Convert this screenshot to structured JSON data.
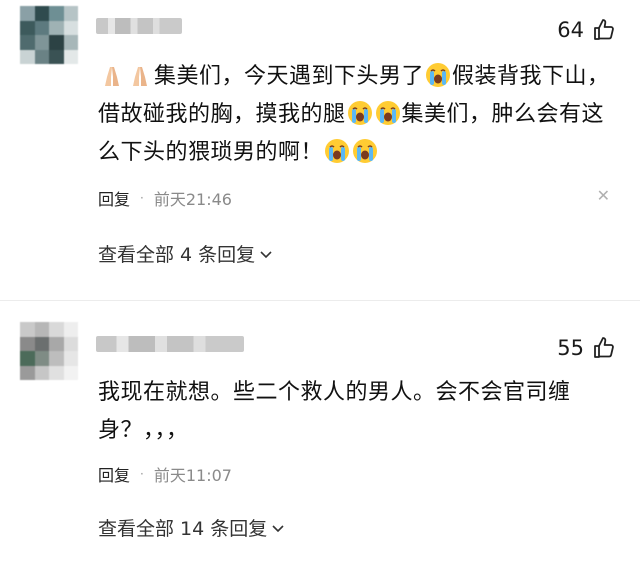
{
  "comments": [
    {
      "like_count": "64",
      "text_segments": [
        "集美们，今天遇到下头男了",
        "假装背我下山，借故碰我的胸，摸我的腿",
        "集美们，肿么会有这么下头的猥琐男的啊！"
      ],
      "reply_label": "回复",
      "time": "前天21:46",
      "view_replies": "查看全部 4 条回复",
      "avatar_colors": [
        "#8aa0a6",
        "#2f4b4e",
        "#6e8f94",
        "#b6c4c6",
        "#3d5a5c",
        "#5d7a7f",
        "#9fb2b4",
        "#d7dfe0",
        "#4f6b6e",
        "#7f9598",
        "#2c4244",
        "#a7b7b9",
        "#c9d3d4",
        "#6a8285",
        "#3a5254",
        "#e3e8e8"
      ],
      "icons": {
        "pray": "folded-hands-emoji",
        "cry": "loudly-crying-emoji",
        "like": "thumbs-up-icon",
        "close": "close-icon",
        "chevron": "chevron-down-icon"
      }
    },
    {
      "like_count": "55",
      "text": "我现在就想。些二个救人的男人。会不会官司缠身？，，，",
      "reply_label": "回复",
      "time": "前天11:07",
      "view_replies": "查看全部 14 条回复",
      "avatar_colors": [
        "#c9c9c9",
        "#b7b7b7",
        "#d9d9d9",
        "#eeeeee",
        "#8a8a8a",
        "#6b6f6f",
        "#a8a8a8",
        "#dcdcdc",
        "#4c6b5a",
        "#7f8c85",
        "#bdbdbd",
        "#e6e6e6",
        "#9a9a9a",
        "#c6c6c6",
        "#e0e0e0",
        "#f2f2f2"
      ]
    }
  ],
  "colors": {
    "text": "#111111",
    "muted": "#8a8a8a",
    "divider": "#ececec"
  }
}
